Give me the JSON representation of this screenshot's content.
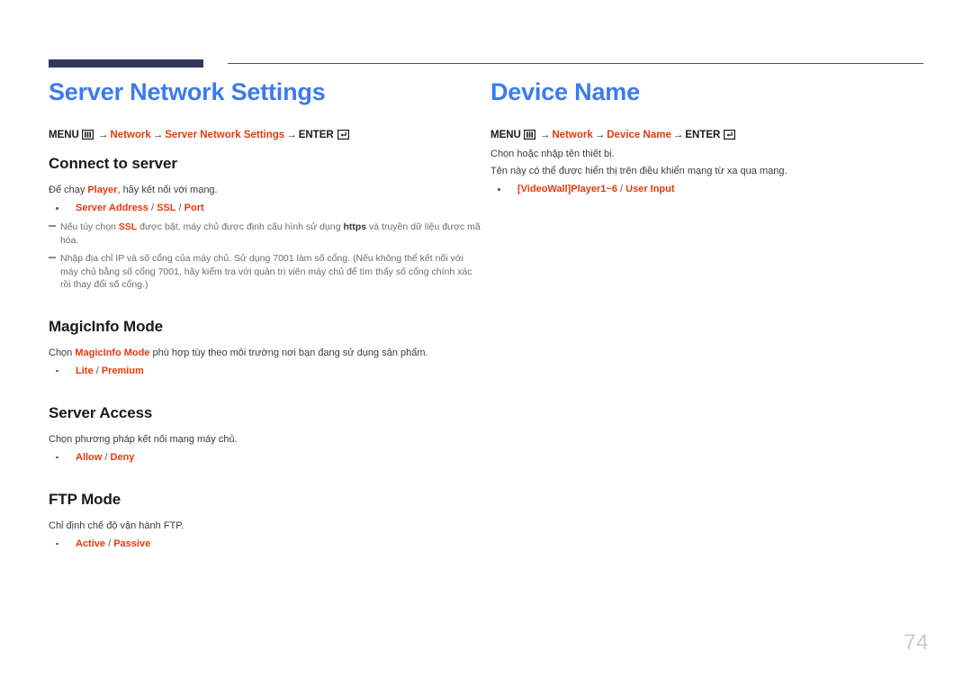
{
  "header": {
    "rule_color_thick": "#32395c",
    "rule_color_thin": "#4a4f6b"
  },
  "colors": {
    "title_blue": "#3b7bed",
    "accent_red": "#e8380d",
    "body_gray": "#3c3c3c",
    "note_gray": "#6d6d6d",
    "page_number_gray": "#c9c9c9"
  },
  "left_column": {
    "title": "Server Network Settings",
    "menu_path": {
      "menu_label": "MENU",
      "menu_icon": "menu-grid-icon",
      "arrow1": "→",
      "item1": "Network",
      "arrow2": "→",
      "item2": "Server Network Settings",
      "arrow3": "→",
      "enter_label": "ENTER",
      "enter_icon": "enter-return-icon"
    },
    "sections": [
      {
        "heading": "Connect to server",
        "body_prefix": "Để chạy ",
        "body_accent": "Player",
        "body_suffix": ", hãy kết nối với mạng.",
        "options": [
          {
            "a": "Server Address",
            "sep1": " / ",
            "b": "SSL",
            "sep2": " / ",
            "c": "Port"
          }
        ],
        "notes": [
          {
            "p1": "Nếu tùy chọn ",
            "accent1": "SSL",
            "p2": " được bật, máy chủ được định cấu hình sử dụng ",
            "bold1": "https",
            "p3": " và truyền dữ liệu được mã hóa."
          },
          {
            "p1": "Nhập địa chỉ IP và số cổng của máy chủ. Sử dụng 7001 làm số cổng. (Nếu không thể kết nối với máy chủ bằng số cổng 7001, hãy kiểm tra với quản trị viên máy chủ để tìm thấy số cổng chính xác rồi thay đổi số cổng.)",
            "accent1": "",
            "p2": "",
            "bold1": "",
            "p3": ""
          }
        ]
      },
      {
        "heading": "MagicInfo Mode",
        "body_prefix": "Chọn ",
        "body_accent": "MagicInfo Mode",
        "body_suffix": " phù hợp tùy theo môi trường nơi bạn đang sử dụng sản phẩm.",
        "options": [
          {
            "a": "Lite",
            "sep1": " / ",
            "b": "Premium",
            "sep2": "",
            "c": ""
          }
        ],
        "notes": []
      },
      {
        "heading": "Server Access",
        "body_prefix": "Chọn phương pháp kết nối mạng máy chủ.",
        "body_accent": "",
        "body_suffix": "",
        "options": [
          {
            "a": "Allow",
            "sep1": " / ",
            "b": "Deny",
            "sep2": "",
            "c": ""
          }
        ],
        "notes": []
      },
      {
        "heading": "FTP Mode",
        "body_prefix": "Chỉ định chế độ vận hành FTP.",
        "body_accent": "",
        "body_suffix": "",
        "options": [
          {
            "a": "Active",
            "sep1": " / ",
            "b": "Passive",
            "sep2": "",
            "c": ""
          }
        ],
        "notes": []
      }
    ]
  },
  "right_column": {
    "title": "Device Name",
    "menu_path": {
      "menu_label": "MENU",
      "menu_icon": "menu-grid-icon",
      "arrow1": "→",
      "item1": "Network",
      "arrow2": "→",
      "item2": "Device Name",
      "arrow3": "→",
      "enter_label": "ENTER",
      "enter_icon": "enter-return-icon"
    },
    "paragraphs": [
      "Chọn hoặc nhập tên thiết bị.",
      "Tên này có thể được hiển thị trên điều khiển mạng từ xa qua mạng."
    ],
    "options": [
      {
        "a": "[VideoWall]Player1~6",
        "sep1": " / ",
        "b": "User Input",
        "sep2": "",
        "c": ""
      }
    ]
  },
  "footer": {
    "page_number": "74"
  }
}
